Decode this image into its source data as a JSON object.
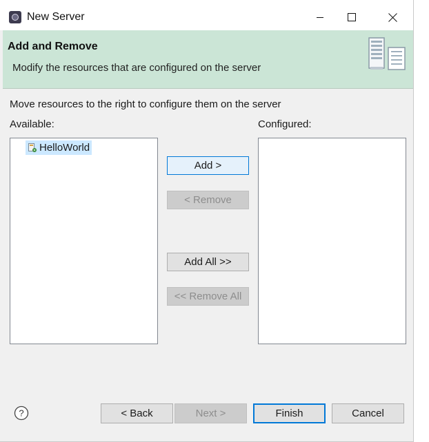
{
  "window": {
    "title": "New Server",
    "controls": {
      "minimize": "minimize",
      "maximize": "maximize",
      "close": "close"
    }
  },
  "banner": {
    "title": "Add and Remove",
    "description": "Modify the resources that are configured on the server",
    "icon": "server-wizard-icon",
    "background_color": "#cbe5d6"
  },
  "content": {
    "instruction": "Move resources to the right to configure them on the server",
    "available_label": "Available:",
    "configured_label": "Configured:",
    "available_items": [
      {
        "label": "HelloWorld",
        "icon": "web-project-icon",
        "selected": true
      }
    ],
    "configured_items": []
  },
  "mid_buttons": {
    "add": "Add >",
    "remove": "< Remove",
    "add_all": "Add All >>",
    "remove_all": "<< Remove All"
  },
  "footer": {
    "help_icon": "help-icon",
    "back": "< Back",
    "next": "Next >",
    "finish": "Finish",
    "cancel": "Cancel"
  },
  "colors": {
    "accent": "#0078d7",
    "selection": "#cce8ff",
    "dialog_bg": "#f0f0f0"
  }
}
